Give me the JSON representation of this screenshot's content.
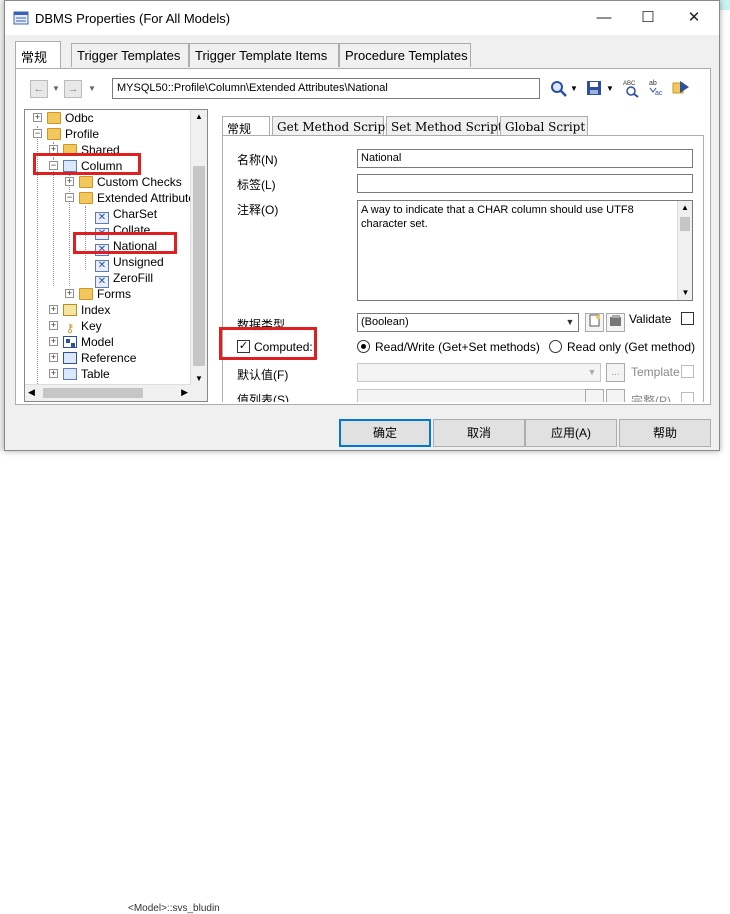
{
  "window": {
    "title": "DBMS Properties (For All Models)",
    "minimize_glyph": "—",
    "maximize_glyph": "☐",
    "close_glyph": "✕"
  },
  "tabs": [
    {
      "label": "常规",
      "active": true
    },
    {
      "label": "Trigger Templates",
      "active": false
    },
    {
      "label": "Trigger Template Items",
      "active": false
    },
    {
      "label": "Procedure Templates",
      "active": false
    }
  ],
  "toolbar": {
    "back_glyph": "←",
    "forward_glyph": "→",
    "path": "MYSQL50::Profile\\Column\\Extended Attributes\\National",
    "find_icon": "search-icon",
    "save_icon": "save-icon",
    "spell_icon": "spellcheck-icon",
    "replace_icon": "replace-icon",
    "locate_icon": "locate-icon"
  },
  "tree": {
    "items": [
      {
        "label": "Odbc",
        "icon": "folder"
      },
      {
        "label": "Profile",
        "icon": "folder"
      },
      {
        "label": "Shared",
        "icon": "folder"
      },
      {
        "label": "Column",
        "icon": "table"
      },
      {
        "label": "Custom Checks",
        "icon": "folder"
      },
      {
        "label": "Extended Attributes",
        "icon": "folder"
      },
      {
        "label": "CharSet",
        "icon": "attribute"
      },
      {
        "label": "Collate",
        "icon": "attribute"
      },
      {
        "label": "National",
        "icon": "attribute"
      },
      {
        "label": "Unsigned",
        "icon": "attribute"
      },
      {
        "label": "ZeroFill",
        "icon": "attribute"
      },
      {
        "label": "Forms",
        "icon": "folder"
      },
      {
        "label": "Index",
        "icon": "index"
      },
      {
        "label": "Key",
        "icon": "key"
      },
      {
        "label": "Model",
        "icon": "model"
      },
      {
        "label": "Reference",
        "icon": "reference"
      },
      {
        "label": "Table",
        "icon": "table"
      }
    ]
  },
  "inner_tabs": [
    {
      "label": "常规",
      "active": true
    },
    {
      "label": "Get Method Script",
      "active": false
    },
    {
      "label": "Set Method Script",
      "active": false
    },
    {
      "label": "Global Script",
      "active": false
    }
  ],
  "form": {
    "name_label": "名称(N)",
    "name_value": "National",
    "tag_label": "标签(L)",
    "tag_value": "",
    "comment_label": "注释(O)",
    "comment_value": "A way to indicate that a CHAR column should use UTF8 character set.",
    "datatype_label": "数据类型",
    "datatype_value": "(Boolean)",
    "validate_label": "Validate",
    "computed_label": "Computed:",
    "computed_checked": true,
    "readwrite_label": "Read/Write (Get+Set methods)",
    "readonly_label": "Read only (Get method)",
    "default_label": "默认值(F)",
    "template_label": "Template",
    "list_label": "值列表(S)",
    "complete_label": "完整(P)",
    "dots_label": "..."
  },
  "buttons": {
    "ok": "确定",
    "cancel": "取消",
    "apply": "应用(A)",
    "help": "帮助"
  },
  "background": {
    "bottom_text": "<Model>::svs_bludin"
  },
  "colors": {
    "highlight_box": "#e02020",
    "default_button_border": "#0078d7"
  }
}
